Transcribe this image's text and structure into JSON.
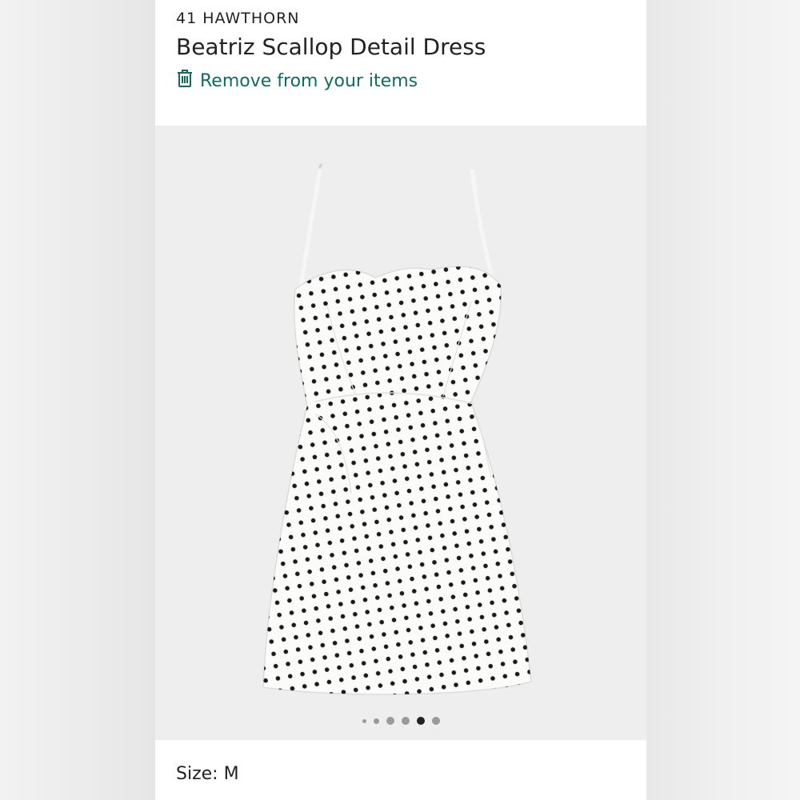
{
  "product": {
    "brand": "41 HAWTHORN",
    "title": "Beatriz Scallop Detail Dress",
    "remove_label": "Remove from your items",
    "remove_icon": "trash-icon",
    "size_text": "Size: M"
  },
  "carousel": {
    "count": 6,
    "active_index": 4
  },
  "colors": {
    "accent": "#0f6b5e",
    "dress": "#fbfbf9",
    "polka": "#1a1a1a"
  }
}
